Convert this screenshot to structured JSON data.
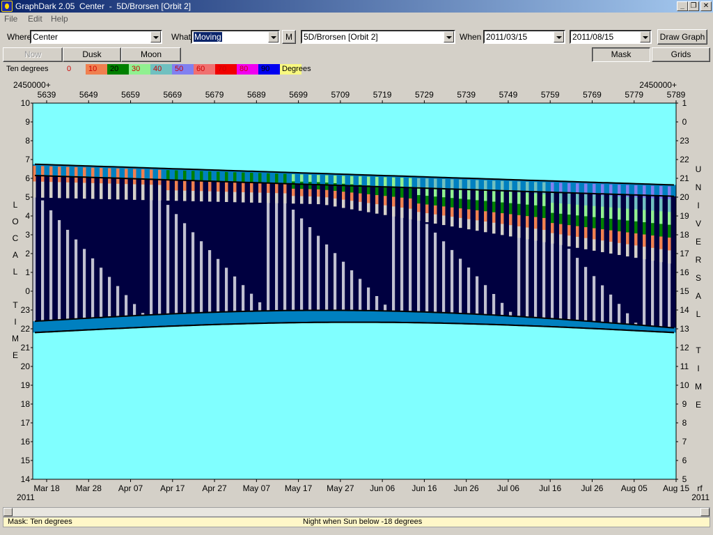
{
  "window": {
    "title": "GraphDark 2.05  Center  -  5D/Brorsen [Orbit 2]",
    "minimize": "_",
    "restore": "❐",
    "close": "✕"
  },
  "menu": [
    "File",
    "Edit",
    "Help"
  ],
  "toolbar": {
    "where_label": "Where",
    "where_value": "Center",
    "what_label": "What",
    "what_value": "Moving",
    "m_button": "M",
    "object_value": "5D/Brorsen [Orbit 2]",
    "when_label": "When",
    "start_date": "2011/03/15",
    "end_date": "2011/08/15",
    "draw_button": "Draw Graph"
  },
  "toolbar2": {
    "now": "Now",
    "dusk": "Dusk",
    "moon": "Moon",
    "mask": "Mask",
    "grids": "Grids"
  },
  "legend": {
    "label": "Ten degrees",
    "units": "Degrees",
    "items": [
      {
        "label": "0",
        "color": "#d4d0c8"
      },
      {
        "label": "10",
        "color": "#f08050"
      },
      {
        "label": "20",
        "color": "#008000"
      },
      {
        "label": "30",
        "color": "#90f090"
      },
      {
        "label": "40",
        "color": "#70c0c0"
      },
      {
        "label": "50",
        "color": "#8080f0"
      },
      {
        "label": "60",
        "color": "#f07070"
      },
      {
        "label": "70",
        "color": "#f00000"
      },
      {
        "label": "80",
        "color": "#f000f0"
      },
      {
        "label": "90",
        "color": "#0000f0"
      },
      {
        "label": "",
        "color": "#f8f880"
      }
    ]
  },
  "chart_data": {
    "type": "heatmap",
    "jd_prefix": "2450000+",
    "jd_ticks": [
      "5639",
      "5649",
      "5659",
      "5669",
      "5679",
      "5689",
      "5699",
      "5709",
      "5719",
      "5729",
      "5739",
      "5749",
      "5759",
      "5769",
      "5779",
      "5789"
    ],
    "date_ticks": [
      "Mar 18",
      "Mar 28",
      "Apr 07",
      "Apr 17",
      "Apr 27",
      "May 07",
      "May 17",
      "May 27",
      "Jun 06",
      "Jun 16",
      "Jun 26",
      "Jul 06",
      "Jul 16",
      "Jul 26",
      "Aug 05",
      "Aug 15"
    ],
    "year_left": "2011",
    "year_right": "2011",
    "corner_label": "rf",
    "local_time_ticks": [
      "10",
      "9",
      "8",
      "7",
      "6",
      "5",
      "4",
      "3",
      "2",
      "1",
      "0",
      "23",
      "22",
      "21",
      "20",
      "19",
      "18",
      "17",
      "16",
      "15",
      "14"
    ],
    "universal_time_ticks": [
      "1",
      "0",
      "23",
      "22",
      "21",
      "20",
      "19",
      "18",
      "17",
      "16",
      "15",
      "14",
      "13",
      "12",
      "11",
      "10",
      "9",
      "8",
      "7",
      "6",
      "5"
    ],
    "left_axis_letters": [
      "L",
      "O",
      "C",
      "A",
      "L",
      "",
      "T",
      "I",
      "M",
      "E"
    ],
    "right_axis_letters": [
      "U",
      "N",
      "I",
      "V",
      "E",
      "R",
      "S",
      "A",
      "L",
      "",
      "T",
      "I",
      "M",
      "E"
    ],
    "colors": {
      "day": "#80ffff",
      "twilight": "#0080c0",
      "night_dark": "#000040",
      "night_moon": "#c0c0d0",
      "band_0": "#d4d0c8",
      "band_10": "#f08050",
      "band_20": "#008000",
      "band_30": "#90f090",
      "band_40": "#70c0c0",
      "band_50": "#8080f0"
    }
  },
  "status": {
    "mask": "Mask:  Ten degrees",
    "night": "Night when Sun below -18 degrees"
  }
}
